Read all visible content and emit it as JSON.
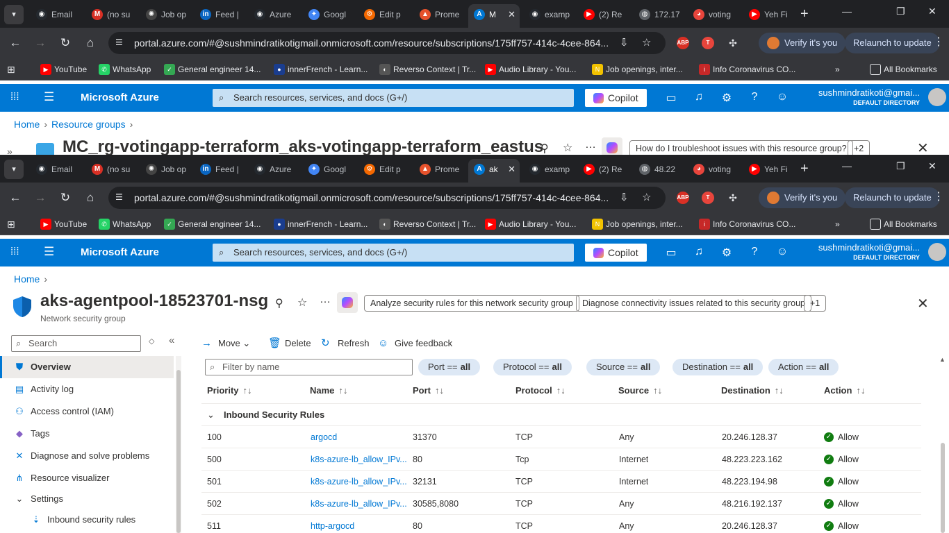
{
  "browser": {
    "tabs_back": [
      "Email",
      "(no su",
      "Job op",
      "Feed |",
      "Azure",
      "Googl",
      "Edit p",
      "Prome",
      "M",
      "examp",
      "(2) Re",
      "172.17",
      "voting",
      "Yeh Fi"
    ],
    "tabs_front": [
      "Email",
      "(no su",
      "Job op",
      "Feed |",
      "Azure",
      "Googl",
      "Edit p",
      "Prome",
      "ak",
      "examp",
      "(2) Re",
      "48.22",
      "voting",
      "Yeh Fi"
    ],
    "url": "portal.azure.com/#@sushmindratikotigmail.onmicrosoft.com/resource/subscriptions/175ff757-414c-4cee-864...",
    "verify_label": "Verify it's you",
    "relaunch_label": "Relaunch to update",
    "bookmarks": [
      "YouTube",
      "WhatsApp",
      "General engineer 14...",
      "innerFrench - Learn...",
      "Reverso Context | Tr...",
      "Audio Library - You...",
      "Job openings, inter...",
      "Info Coronavirus CO..."
    ],
    "all_bookmarks": "All Bookmarks",
    "ext_abp": "ABP"
  },
  "azure": {
    "brand": "Microsoft Azure",
    "search_placeholder": "Search resources, services, and docs (G+/)",
    "copilot_label": "Copilot",
    "account_email": "sushmindratikoti@gmai...",
    "account_dir": "DEFAULT DIRECTORY"
  },
  "back_page": {
    "breadcrumb_home": "Home",
    "breadcrumb_rg": "Resource groups",
    "title": "MC_rg-votingapp-terraform_aks-votingapp-terraform_eastus",
    "chip_question": "How do I troubleshoot issues with this resource group?",
    "chip_more": "+2"
  },
  "page": {
    "breadcrumb_home": "Home",
    "title": "aks-agentpool-18523701-nsg",
    "subtitle": "Network security group",
    "chip_analyze": "Analyze security rules for this network security group",
    "chip_diagnose": "Diagnose connectivity issues related to this security group",
    "chip_more": "+1",
    "left_search_placeholder": "Search",
    "nav": [
      {
        "label": "Overview"
      },
      {
        "label": "Activity log"
      },
      {
        "label": "Access control (IAM)"
      },
      {
        "label": "Tags"
      },
      {
        "label": "Diagnose and solve problems"
      },
      {
        "label": "Resource visualizer"
      },
      {
        "label": "Settings"
      },
      {
        "label": "Inbound security rules"
      }
    ],
    "commands": {
      "move": "Move",
      "delete": "Delete",
      "refresh": "Refresh",
      "feedback": "Give feedback"
    },
    "filter_placeholder": "Filter by name",
    "filters": [
      {
        "key": "Port ==",
        "value": "all"
      },
      {
        "key": "Protocol ==",
        "value": "all"
      },
      {
        "key": "Source ==",
        "value": "all"
      },
      {
        "key": "Destination ==",
        "value": "all"
      },
      {
        "key": "Action ==",
        "value": "all"
      }
    ],
    "columns": [
      "Priority",
      "Name",
      "Port",
      "Protocol",
      "Source",
      "Destination",
      "Action"
    ],
    "group_label": "Inbound Security Rules",
    "rows": [
      {
        "priority": "100",
        "name": "argocd",
        "port": "31370",
        "protocol": "TCP",
        "source": "Any",
        "destination": "20.246.128.37",
        "action": "Allow"
      },
      {
        "priority": "500",
        "name": "k8s-azure-lb_allow_IPv...",
        "port": "80",
        "protocol": "Tcp",
        "source": "Internet",
        "destination": "48.223.223.162",
        "action": "Allow"
      },
      {
        "priority": "501",
        "name": "k8s-azure-lb_allow_IPv...",
        "port": "32131",
        "protocol": "TCP",
        "source": "Internet",
        "destination": "48.223.194.98",
        "action": "Allow"
      },
      {
        "priority": "502",
        "name": "k8s-azure-lb_allow_IPv...",
        "port": "30585,8080",
        "protocol": "TCP",
        "source": "Any",
        "destination": "48.216.192.137",
        "action": "Allow"
      },
      {
        "priority": "511",
        "name": "http-argocd",
        "port": "80",
        "protocol": "TCP",
        "source": "Any",
        "destination": "20.246.128.37",
        "action": "Allow"
      }
    ]
  }
}
